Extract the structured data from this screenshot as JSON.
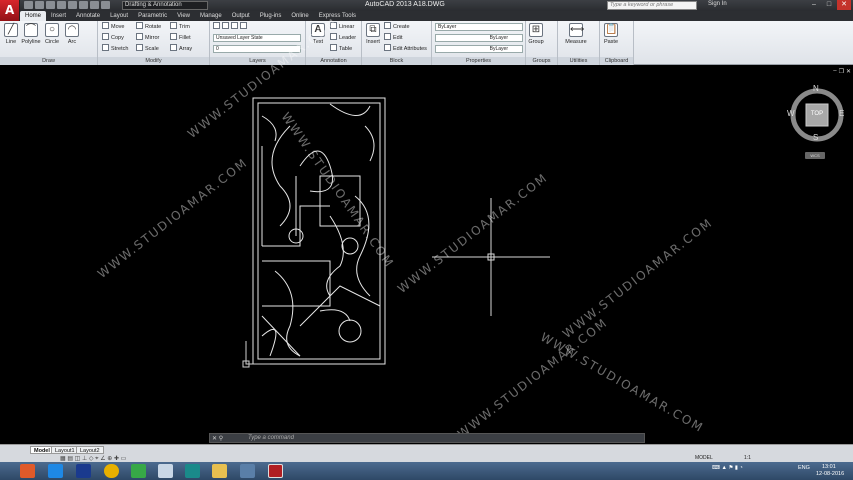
{
  "titlebar": {
    "workspace": "Drafting & Annotation",
    "title": "AutoCAD 2013    A18.DWG",
    "search_placeholder": "Type a keyword or phrase",
    "signin": "Sign In"
  },
  "tabs": [
    "Home",
    "Insert",
    "Annotate",
    "Layout",
    "Parametric",
    "View",
    "Manage",
    "Output",
    "Plug-ins",
    "Online",
    "Express Tools"
  ],
  "ribbon": {
    "draw": {
      "title": "Draw",
      "line": "Line",
      "polyline": "Polyline",
      "circle": "Circle",
      "arc": "Arc"
    },
    "modify": {
      "title": "Modify",
      "move": "Move",
      "rotate": "Rotate",
      "trim": "Trim",
      "copy": "Copy",
      "mirror": "Mirror",
      "fillet": "Fillet",
      "stretch": "Stretch",
      "scale": "Scale",
      "array": "Array"
    },
    "layers": {
      "title": "Layers",
      "layer_state": "Unsaved Layer State",
      "layer_current": "0"
    },
    "annotation": {
      "title": "Annotation",
      "text": "Text",
      "linear": "Linear",
      "leader": "Leader",
      "table": "Table"
    },
    "block": {
      "title": "Block",
      "insert": "Insert",
      "create": "Create",
      "edit": "Edit",
      "edit_attributes": "Edit Attributes"
    },
    "properties": {
      "title": "Properties",
      "color": "ByLayer",
      "linetype": "ByLayer",
      "lineweight": "ByLayer"
    },
    "groups": {
      "title": "Groups",
      "group": "Group"
    },
    "utilities": {
      "title": "Utilities",
      "measure": "Measure"
    },
    "clipboard": {
      "title": "Clipboard",
      "paste": "Paste"
    }
  },
  "viewcube": {
    "n": "N",
    "s": "S",
    "e": "E",
    "w": "W",
    "face": "TOP",
    "wcs": "WCS"
  },
  "watermark": "WWW.STUDIOAMAR.COM",
  "command": {
    "placeholder": "Type a command"
  },
  "layout_tabs": [
    "Model",
    "Layout1",
    "Layout2"
  ],
  "status": {
    "model": "MODEL",
    "scale": "1:1"
  },
  "taskbar": {
    "lang": "ENG",
    "time": "13:01",
    "date": "12-08-2016"
  }
}
